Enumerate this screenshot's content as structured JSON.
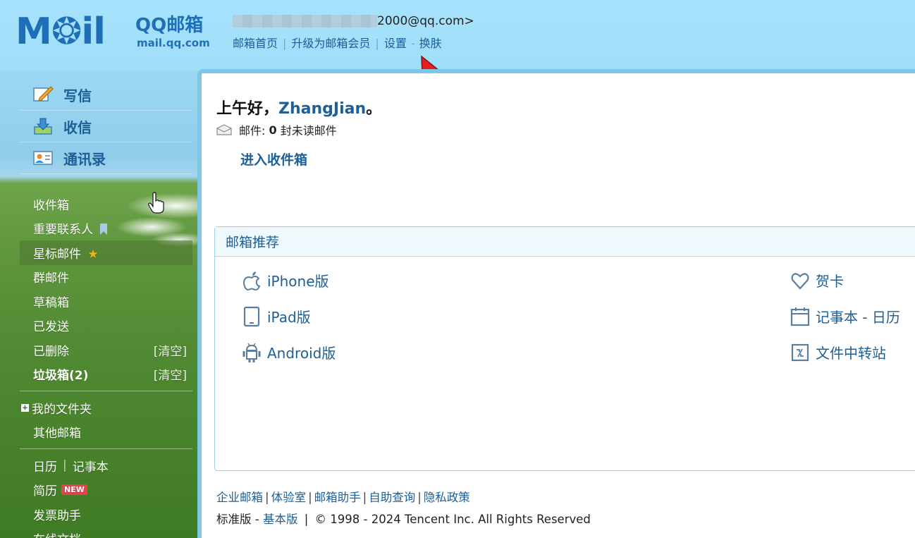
{
  "header": {
    "logo_text": "M❂il",
    "brand": "QQ邮箱",
    "domain": "mail.qq.com",
    "account_suffix": "2000@qq.com>",
    "links": [
      "邮箱首页",
      "升级为邮箱会员",
      "设置",
      "换肤"
    ]
  },
  "sidebar": {
    "main_items": [
      {
        "label": "写信",
        "icon": "compose-icon"
      },
      {
        "label": "收信",
        "icon": "inbox-download-icon"
      },
      {
        "label": "通讯录",
        "icon": "contacts-icon"
      }
    ],
    "folders": [
      {
        "label": "收件箱"
      },
      {
        "label": "重要联系人"
      },
      {
        "label": "星标邮件"
      },
      {
        "label": "群邮件"
      },
      {
        "label": "草稿箱"
      },
      {
        "label": "已发送"
      },
      {
        "label": "已删除",
        "action": "[清空]"
      },
      {
        "label": "垃圾箱(2)",
        "action": "[清空]"
      }
    ],
    "folders2": [
      {
        "label": "我的文件夹"
      },
      {
        "label": "其他邮箱"
      }
    ],
    "tools": [
      {
        "label": "日历",
        "label2": "记事本"
      },
      {
        "label": "简历",
        "badge": "NEW"
      },
      {
        "label": "发票助手"
      },
      {
        "label": "在线文档"
      }
    ]
  },
  "main": {
    "greeting": "上午好，",
    "user_name": "ZhangJian",
    "greeting_end": "。",
    "mail_label": "邮件:",
    "unread_count": "0",
    "unread_text": "封未读邮件",
    "enter_inbox": "进入收件箱",
    "recommend_title": "邮箱推荐",
    "left_items": [
      {
        "label": "iPhone版",
        "icon": "apple-icon"
      },
      {
        "label": "iPad版",
        "icon": "tablet-icon"
      },
      {
        "label": "Android版",
        "icon": "android-icon"
      }
    ],
    "right_items": [
      {
        "label": "贺卡",
        "icon": "heart-icon"
      },
      {
        "label": "记事本 - 日历",
        "icon": "calendar-icon"
      },
      {
        "label": "文件中转站",
        "icon": "file-transfer-icon"
      }
    ]
  },
  "footer": {
    "links": [
      "企业邮箱",
      "体验室",
      "邮箱助手",
      "自助查询",
      "隐私政策"
    ],
    "edition": "标准版",
    "basic": "基本版",
    "copyright": "© 1998 - 2024 Tencent Inc. All Rights Reserved"
  }
}
